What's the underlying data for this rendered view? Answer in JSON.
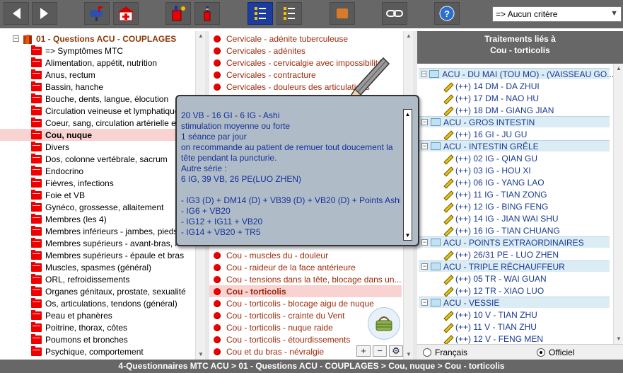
{
  "toolbar": {
    "criteria_value": "=> Aucun critère",
    "buttons": [
      "back-button",
      "forward-button",
      "mailbox-button",
      "clinic-button",
      "paint-red-button",
      "paint-small-button",
      "list-view-button",
      "detail-view-button",
      "orange-button",
      "link-button",
      "help-button"
    ],
    "help_label": "?"
  },
  "left": {
    "root_label": "01 - Questions ACU - COUPLAGES",
    "items": [
      "=> Symptômes MTC",
      "Alimentation, appétit, nutrition",
      "Anus, rectum",
      "Bassin, hanche",
      "Bouche, dents, langue, élocution",
      "Circulation veineuse et lymphatique",
      "Coeur, sang, circulation artérielle et",
      "Cou, nuque",
      "Divers",
      "Dos, colonne vertébrale, sacrum",
      "Endocrino",
      "Fièvres, infections",
      "Foie et VB",
      "Gynéco, grossesse, allaitement",
      "Membres (les 4)",
      "Membres inférieurs - jambes, pieds",
      "Membres supérieurs - avant-bras, mains",
      "Membres supérieurs - épaule et bras",
      "Muscles, spasmes (général)",
      "ORL, refroidissements",
      "Organes génitaux, prostate, sexualité",
      "Os, articulations, tendons (général)",
      "Peau et phanères",
      "Poitrine, thorax, côtes",
      "Poumons et bronches",
      "Psychique, comportement"
    ]
  },
  "middle": {
    "items": [
      "Cervicale - adénite tuberculeuse",
      "Cervicales - adénites",
      "Cervicales - cervicalgie avec impossibilité",
      "Cervicales - contracture",
      "Cervicales - douleurs des articulations",
      "",
      "",
      "",
      "",
      "",
      "",
      "",
      "",
      "",
      "",
      "",
      "",
      "",
      "Cou - muscles du - douleur",
      "Cou - raideur de la face antérieure",
      "Cou - tensions dans la tête, blocage dans un...",
      "Cou - torticolis",
      "Cou - torticolis - blocage aigu de nuque",
      "Cou - torticolis - crainte du Vent",
      "Cou - torticolis - nuque raide",
      "Cou - torticolis - étourdissements",
      "Cou et du bras - névralgie"
    ],
    "plus_label": "+",
    "minus_label": "−",
    "settings_label": "⚙"
  },
  "note": {
    "lines": [
      "20 VB - 16 GI - 6 IG - Ashi",
      "stimulation moyenne ou forte",
      "1 séance par jour",
      "on recommande au patient de remuer tout doucement la",
      "tête   pendant la puncturie.",
      "Autre série :",
      "6 IG, 39 VB, 26 PE(LUO ZHEN)",
      "",
      "- IG3 (D) + DM14 (D) + VB39 (D) + VB20 (D) + Points Ashi",
      "- IG6 + VB20",
      "- IG12 + IG11 + VB20",
      "- IG14 + VB20 + TR5"
    ]
  },
  "right": {
    "header_line1": "Traitements liés à",
    "header_line2": "Cou - torticolis",
    "groups": [
      {
        "label": "ACU - DU MAI (TOU MO) - (VAISSEAU GO...",
        "items": [
          "(++) 14 DM - DA ZHUI",
          "(++) 17 DM - NAO HU",
          "(++) 18 DM - GIANG JIAN"
        ]
      },
      {
        "label": "ACU - GROS INTESTIN",
        "items": [
          "(++) 16 GI - JU GU"
        ]
      },
      {
        "label": "ACU - INTESTIN GRÊLE",
        "items": [
          "(++) 02 IG - QIAN GU",
          "(++) 03 IG - HOU XI",
          "(++) 06 IG - YANG LAO",
          "(++) 11 IG - TIAN ZONG",
          "(++) 12 IG - BING FENG",
          "(++) 14 IG - JIAN WAI SHU",
          "(++) 16 IG - TIAN CHUANG"
        ]
      },
      {
        "label": "ACU - POINTS EXTRAORDINAIRES",
        "items": [
          "(++) 26/31 PE - LUO ZHEN"
        ]
      },
      {
        "label": "ACU - TRIPLE RÉCHAUFFEUR",
        "items": [
          "(++) 05 TR - WAI GUAN",
          "(++) 12 TR - XIAO LUO"
        ]
      },
      {
        "label": "ACU - VESSIE",
        "items": [
          "(++) 10 V - TIAN ZHU",
          "(++) 11 V - TIAN ZHU",
          "(++) 12 V - FENG MEN"
        ]
      }
    ],
    "radio_fr": "Français",
    "radio_off": "Officiel",
    "selected_radio": "Officiel"
  },
  "status": {
    "path": "4-Questionnaires MTC ACU  >  01 - Questions ACU - COUPLAGES  >  Cou, nuque  >  Cou - torticolis"
  },
  "colors": {
    "toolbar": "#676767",
    "selected_row": "#f9d2d2",
    "note_bg": "#afbcc8",
    "note_text": "#16309a",
    "group_bg": "#dcecf5"
  }
}
